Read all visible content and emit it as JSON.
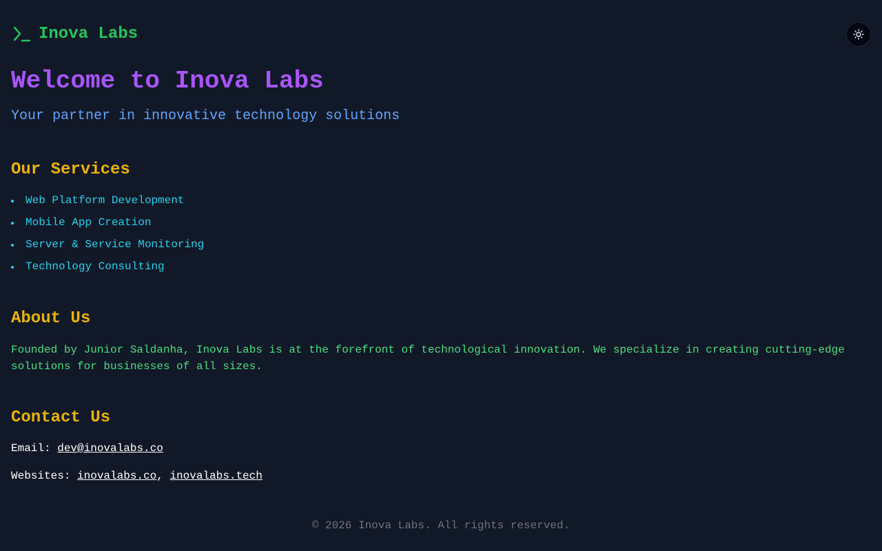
{
  "header": {
    "logo_icon": "terminal-prompt-icon",
    "brand_name": "Inova Labs",
    "theme_toggle_icon": "sun-icon"
  },
  "hero": {
    "title": "Welcome to Inova Labs",
    "subtitle": "Your partner in innovative technology solutions"
  },
  "services": {
    "title": "Our Services",
    "items": [
      "Web Platform Development",
      "Mobile App Creation",
      "Server & Service Monitoring",
      "Technology Consulting"
    ]
  },
  "about": {
    "title": "About Us",
    "text": "Founded by Junior Saldanha, Inova Labs is at the forefront of technological innovation. We specialize in creating cutting-edge solutions for businesses of all sizes."
  },
  "contact": {
    "title": "Contact Us",
    "email_label": "Email: ",
    "email": "dev@inovalabs.co",
    "websites_label": "Websites: ",
    "website_1": "inovalabs.co",
    "separator": ", ",
    "website_2": "inovalabs.tech"
  },
  "footer": {
    "text": "© 2026 Inova Labs. All rights reserved."
  },
  "colors": {
    "background": "#111827",
    "brand": "#22c55e",
    "hero_title": "#a855f7",
    "subtitle": "#60a5fa",
    "section_title": "#eab308",
    "services_text": "#22d3ee",
    "about_text": "#4ade80",
    "footer_text": "#6b7280"
  }
}
